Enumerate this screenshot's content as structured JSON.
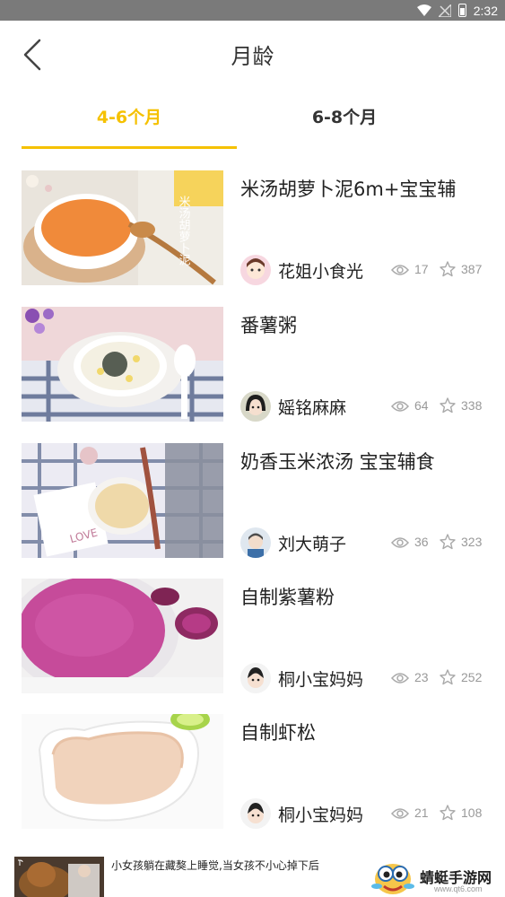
{
  "status_bar": {
    "time": "2:32"
  },
  "header": {
    "title": "月龄"
  },
  "tabs": [
    {
      "label": "4-6个月",
      "active": true
    },
    {
      "label": "6-8个月",
      "active": false
    }
  ],
  "colors": {
    "accent": "#f5c100",
    "status_bar": "#7a7a7a"
  },
  "recipes": [
    {
      "title": "米汤胡萝卜泥6m+宝宝辅",
      "author": "花姐小食光",
      "views": "17",
      "likes": "387"
    },
    {
      "title": "番薯粥",
      "author": "媱铭麻麻",
      "views": "64",
      "likes": "338"
    },
    {
      "title": "奶香玉米浓汤 宝宝辅食",
      "author": "刘大萌子",
      "views": "36",
      "likes": "323"
    },
    {
      "title": "自制紫薯粉",
      "author": "桐小宝妈妈",
      "views": "23",
      "likes": "252"
    },
    {
      "title": "自制虾松",
      "author": "桐小宝妈妈",
      "views": "21",
      "likes": "108"
    }
  ],
  "thumb_overlay_text": "米汤胡萝卜泥",
  "ad": {
    "text": "小女孩躺在藏獒上睡觉,当女孩不小心掉下后",
    "brand": "蜻蜓手游网",
    "url": "www.qt6.com"
  }
}
